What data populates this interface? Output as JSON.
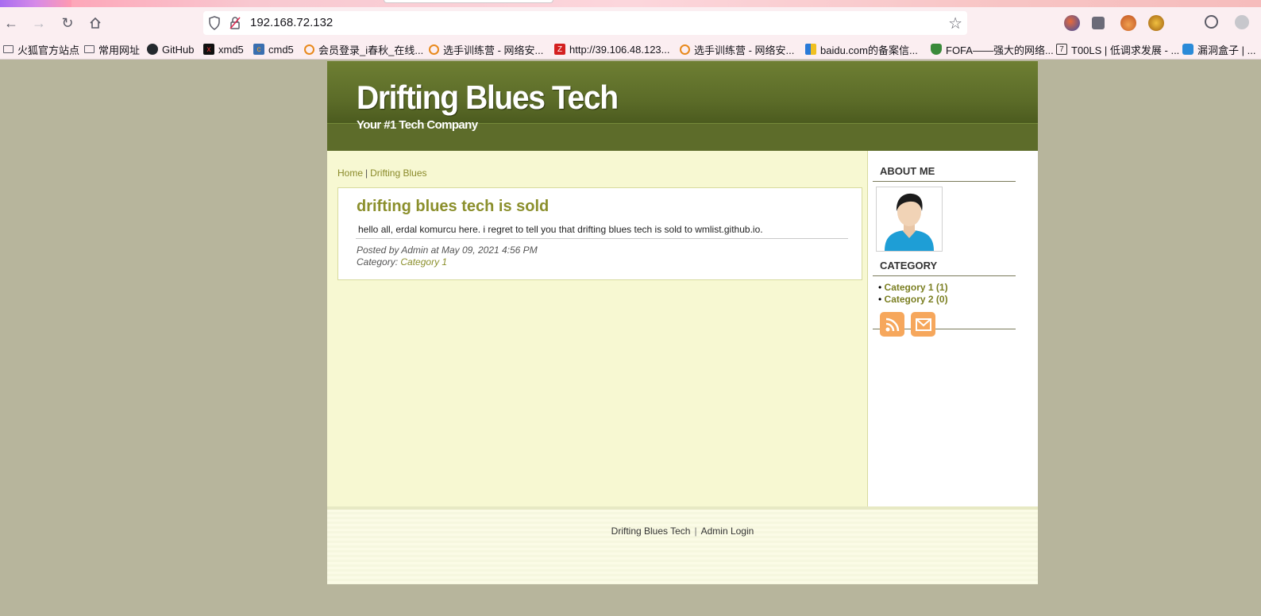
{
  "browser": {
    "url": "192.168.72.132",
    "bookmarks": [
      {
        "label": "火狐官方站点",
        "icon": "folder-icon"
      },
      {
        "label": "常用网址",
        "icon": "folder-icon"
      },
      {
        "label": "GitHub",
        "icon": "github-icon"
      },
      {
        "label": "xmd5",
        "icon": "xmd5-icon"
      },
      {
        "label": "cmd5",
        "icon": "cmd5-icon"
      },
      {
        "label": "会员登录_i春秋_在线...",
        "icon": "ichunqiu-icon"
      },
      {
        "label": "选手训练营 - 网络安...",
        "icon": "ichunqiu-icon"
      },
      {
        "label": "http://39.106.48.123...",
        "icon": "z-icon"
      },
      {
        "label": "选手训练营 - 网络安...",
        "icon": "ichunqiu-icon"
      },
      {
        "label": "baidu.com的备案信...",
        "icon": "baidu-icon"
      },
      {
        "label": "FOFA——强大的网络...",
        "icon": "fofa-icon"
      },
      {
        "label": "T00LS | 低调求发展 - ...",
        "icon": "tools-icon"
      },
      {
        "label": "漏洞盒子 | ...",
        "icon": "vulbox-icon"
      }
    ]
  },
  "site": {
    "title": "Drifting Blues Tech",
    "tagline": "Your #1 Tech Company"
  },
  "breadcrumb": {
    "home": "Home",
    "current": "Drifting Blues"
  },
  "post": {
    "title": "drifting blues tech is sold",
    "body": "hello all, erdal komurcu here. i regret to tell you that drifting blues tech is sold to wmlist.github.io.",
    "meta_posted": "Posted by Admin at May 09, 2021 4:56 PM",
    "category_label": "Category:",
    "category_link": "Category 1"
  },
  "sidebar": {
    "about_heading": "ABOUT ME",
    "category_heading": "CATEGORY",
    "categories": [
      {
        "label": "Category 1 (1)"
      },
      {
        "label": "Category 2 (0)"
      }
    ]
  },
  "footer": {
    "site_link": "Drifting Blues Tech",
    "separator": "|",
    "admin_link": "Admin Login"
  },
  "colors": {
    "header": "#5b6b28",
    "content_bg": "#f7f8d2",
    "link": "#8b8f2c",
    "page_bg": "#b7b59c"
  }
}
